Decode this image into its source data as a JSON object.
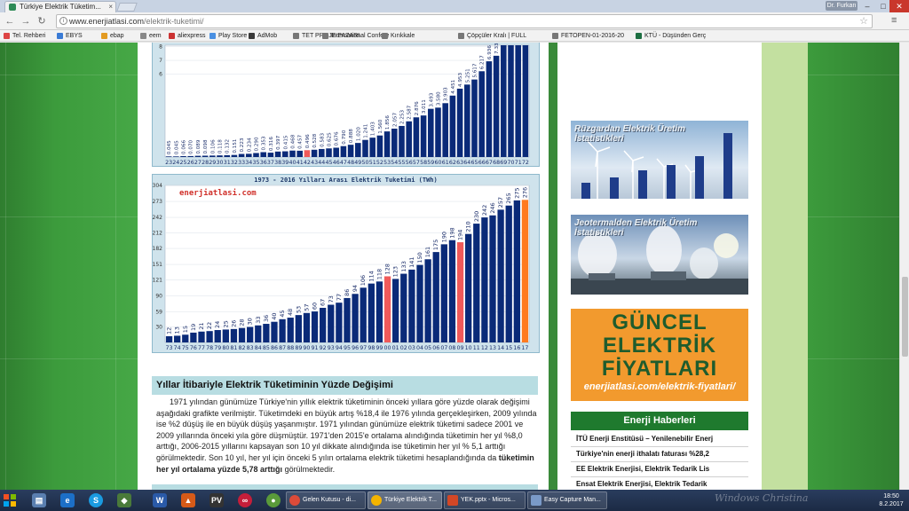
{
  "browser": {
    "tab_title": "Türkiye Elektrik Tüketim...",
    "tab_close": "×",
    "user": "Dr. Furkan",
    "url_host": "www.enerjiatlasi.com",
    "url_path": "/elektrik-tuketimi/",
    "bookmarks": [
      "Tel. Rehberi",
      "EBYS",
      "ebap",
      "eem",
      "aliexpress",
      "Play Store",
      "AdMob",
      "TET PROJE PAZARI",
      "International Confere",
      "Kırıkkale",
      "Çöpçüler Kralı | FULL",
      "FETOPEN-01-2016-20",
      "KTÜ - Düşünden Gerç"
    ]
  },
  "chart_data": [
    {
      "type": "bar",
      "title": "",
      "categories": [
        "23",
        "24",
        "25",
        "26",
        "27",
        "28",
        "29",
        "30",
        "31",
        "32",
        "33",
        "34",
        "35",
        "36",
        "37",
        "38",
        "39",
        "40",
        "41",
        "42",
        "43",
        "44",
        "45",
        "46",
        "47",
        "48",
        "49",
        "50",
        "51",
        "52",
        "53",
        "54",
        "55",
        "56",
        "57",
        "58",
        "59",
        "60",
        "61",
        "62",
        "63",
        "64",
        "65",
        "66",
        "67",
        "68",
        "69",
        "70",
        "71",
        "72"
      ],
      "values": [
        0.045,
        0.045,
        0.066,
        0.07,
        0.089,
        0.098,
        0.106,
        0.118,
        0.132,
        0.151,
        0.223,
        0.234,
        0.29,
        0.353,
        0.316,
        0.397,
        0.415,
        0.468,
        0.457,
        0.496,
        0.528,
        0.583,
        0.625,
        0.676,
        0.79,
        0.888,
        1.02,
        1.241,
        1.403,
        1.56,
        1.856,
        2.057,
        2.253,
        2.587,
        2.876,
        3.011,
        3.493,
        3.58,
        3.903,
        4.451,
        4.953,
        5.251,
        5.617,
        6.217,
        6.936,
        7.338,
        8.289,
        8.7,
        9.2,
        9.6
      ],
      "highlight_index": 19,
      "y_ticks": [
        6,
        7,
        8
      ],
      "colors": {
        "bar": "#0a2a78",
        "highlight": "#f05a5a",
        "label": "#1a2d6a"
      }
    },
    {
      "type": "bar",
      "title": "1973 - 2016 Yılları Arası Elektrik Tuketimi (TWh)",
      "watermark": "enerjiatlasi.com",
      "categories": [
        "73",
        "74",
        "75",
        "76",
        "77",
        "78",
        "79",
        "80",
        "81",
        "82",
        "83",
        "84",
        "85",
        "86",
        "87",
        "88",
        "89",
        "90",
        "91",
        "92",
        "93",
        "94",
        "95",
        "96",
        "97",
        "98",
        "99",
        "00",
        "01",
        "02",
        "03",
        "04",
        "05",
        "06",
        "07",
        "08",
        "09",
        "10",
        "11",
        "12",
        "13",
        "14",
        "15",
        "16",
        "17"
      ],
      "values": [
        12,
        13,
        15,
        19,
        21,
        22,
        24,
        25,
        26,
        28,
        30,
        33,
        36,
        40,
        45,
        48,
        53,
        57,
        60,
        67,
        73,
        77,
        86,
        94,
        106,
        114,
        118,
        128,
        123,
        133,
        141,
        150,
        161,
        175,
        190,
        198,
        194,
        210,
        230,
        242,
        246,
        257,
        265,
        275,
        276
      ],
      "highlight_indices": [
        27,
        36
      ],
      "current_index": 44,
      "y_ticks": [
        30,
        59,
        90,
        121,
        151,
        182,
        212,
        242,
        273,
        304
      ],
      "ylim": [
        0,
        304
      ],
      "colors": {
        "bar": "#0a2a78",
        "highlight": "#f05a5a",
        "current": "#ff7a1f",
        "label": "#1a2d6a"
      }
    }
  ],
  "section": {
    "heading": "Yıllar İtibariyle Elektrik Tüketiminin Yüzde Değişimi",
    "paragraph": "1971 yılından günümüze Türkiye'nin yıllık elektrik tüketiminin önceki yıllara göre yüzde olarak değişimi aşağıdaki grafikte verilmiştir. Tüketimdeki en büyük artış %18,4 ile 1976 yılında gerçekleşirken, 2009 yılında ise %2 düşüş ile en büyük düşüş yaşanmıştır. 1971 yılından günümüze elektrik tüketimi sadece 2001 ve 2009 yıllarında önceki yıla göre düşmüştür. 1971'den 2015'e ortalama alındığında tüketimin her yıl %8,0 arttığı, 2006-2015 yıllarını kapsayan son 10 yıl dikkate alındığında ise tüketimin her yıl % 5,1 arttığı görülmektedir. Son 10 yıl, her yıl için önceki 5 yılın ortalama elektrik tüketimi hesaplandığında da ",
    "paragraph_bold": "tüketimin her yıl ortalama yüzde 5,78 arttığı",
    "paragraph_end": " görülmektedir."
  },
  "sidebar": {
    "wind_banner": "Rüzgardan Elektrik Üretim İstatistikleri",
    "geo_banner": "Jeotermalden Elektrik Üretim İstatistikleri",
    "price_lines": [
      "GÜNCEL",
      "ELEKTRİK",
      "FİYATLARI"
    ],
    "price_url": "enerjiatlasi.com/elektrik-fiyatlari/",
    "news_header": "Enerji Haberleri",
    "news": [
      "İTÜ Enerji Enstitüsü – Yenilenebilir Enerj",
      "Türkiye'nin enerji ithalatı faturası %28,2",
      "EE Elektrik Enerjisi, Elektrik Tedarik Lis",
      "Ensat Elektrik Enerjisi, Elektrik Tedarik"
    ]
  },
  "taskbar": {
    "windows": [
      "Gelen Kutusu - di...",
      "Türkiye Elektrik T...",
      "YEK.pptx - Micros...",
      "Easy Capture Man..."
    ],
    "watermark": "Windows Christina",
    "time": "18:50",
    "date": "8.2.2017"
  }
}
